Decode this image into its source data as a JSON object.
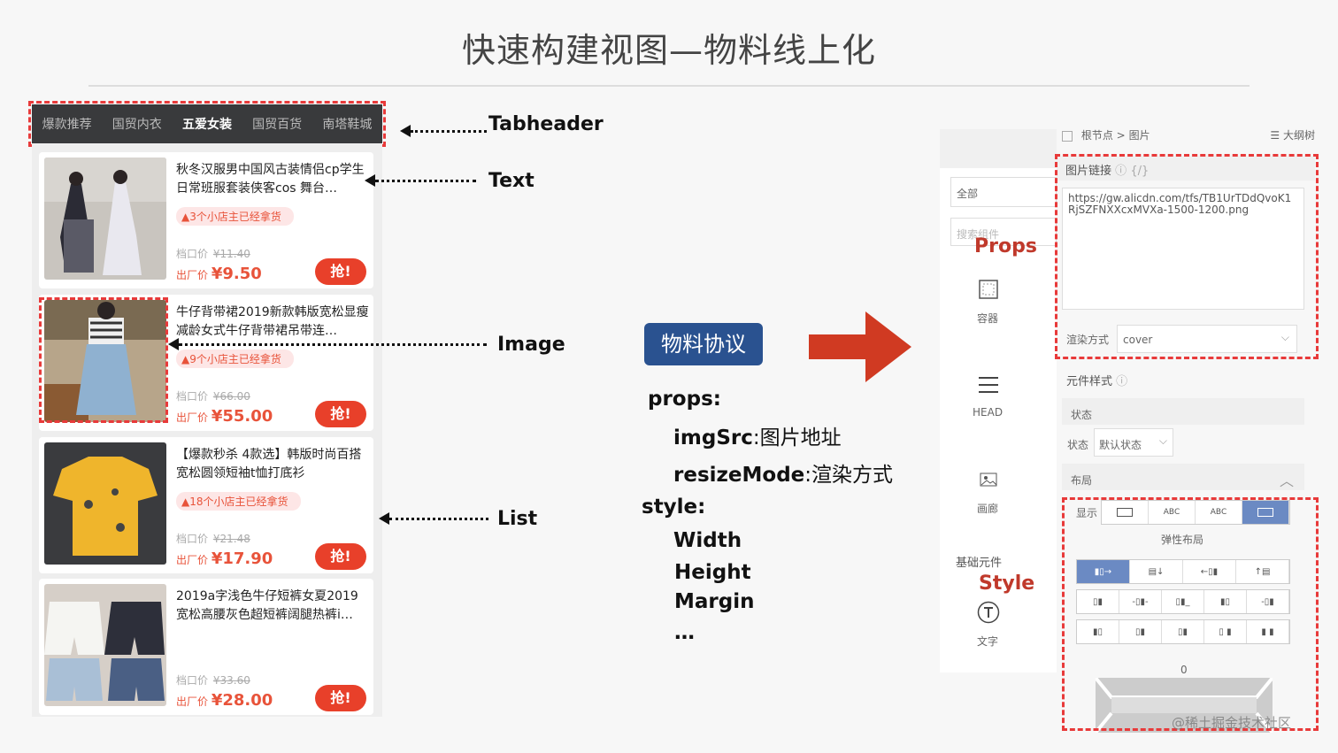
{
  "slide": {
    "title": "快速构建视图—物料线上化"
  },
  "phone": {
    "tabs": [
      "爆款推荐",
      "国贸内衣",
      "五爱女装",
      "国贸百货",
      "南塔鞋城"
    ],
    "active_tab": "五爱女装",
    "products": [
      {
        "name": "秋冬汉服男中国风古装情侣cp学生日常班服套装侠客cos 舞台…",
        "badge": "3个小店主已经拿货",
        "orig_label": "档口价",
        "orig_price": "¥11.40",
        "price_label": "出厂价",
        "price": "¥9.50",
        "buy": "抢!"
      },
      {
        "name": "牛仔背带裙2019新款韩版宽松显瘦减龄女式牛仔背带裙吊带连…",
        "badge": "9个小店主已经拿货",
        "orig_label": "档口价",
        "orig_price": "¥66.00",
        "price_label": "出厂价",
        "price": "¥55.00",
        "buy": "抢!"
      },
      {
        "name": "【爆款秒杀 4款选】韩版时尚百搭宽松圆领短袖t恤打底衫",
        "badge": "18个小店主已经拿货",
        "orig_label": "档口价",
        "orig_price": "¥21.48",
        "price_label": "出厂价",
        "price": "¥17.90",
        "buy": "抢!"
      },
      {
        "name": "2019a字浅色牛仔短裤女夏2019宽松高腰灰色超短裤阔腿热裤i…",
        "badge": "",
        "orig_label": "档口价",
        "orig_price": "¥33.60",
        "price_label": "出厂价",
        "price": "¥28.00",
        "buy": "抢!"
      }
    ]
  },
  "annotations": {
    "tabheader": "Tabheader",
    "text": "Text",
    "image": "Image",
    "list": "List"
  },
  "protocol": {
    "button": "物料协议",
    "props_key": "props:",
    "imgsrc_key": "imgSrc",
    "imgsrc_desc": ":图片地址",
    "resize_key": "resizeMode",
    "resize_desc": ":渲染方式",
    "style_key": "style:",
    "width": "Width",
    "height": "Height",
    "margin": "Margin",
    "more": "…"
  },
  "editor": {
    "breadcrumb_root": "根节点",
    "breadcrumb_sep": ">",
    "breadcrumb_leaf": "图片",
    "outline": "大纲树",
    "filter_all": "全部",
    "search_placeholder": "搜索组件",
    "props_label": "Props",
    "comp_container": "容器",
    "comp_head": "HEAD",
    "comp_gallery": "画廊",
    "basic_section": "基础元件",
    "style_label": "Style",
    "comp_text": "文字",
    "img_link_label": "图片链接",
    "img_link_token": "{/}",
    "img_url": "https://gw.alicdn.com/tfs/TB1UrTDdQvoK1RjSZFNXXcxMVXa-1500-1200.png",
    "render_mode_label": "渲染方式",
    "render_mode_value": "cover",
    "elem_style_label": "元件样式",
    "state_header": "状态",
    "state_label": "状态",
    "state_value": "默认状态",
    "layout_label": "布局",
    "display_label": "显示",
    "display_options": [
      "",
      "ABC",
      "ABC",
      ""
    ],
    "flex_label": "弹性布局",
    "zero": "0",
    "watermark": "@稀土掘金技术社区"
  },
  "colors": {
    "accent_red": "#e83a3a",
    "protocol_blue": "#2a5290",
    "tabbar_bg": "#393a3c",
    "big_arrow": "#d03a22"
  }
}
